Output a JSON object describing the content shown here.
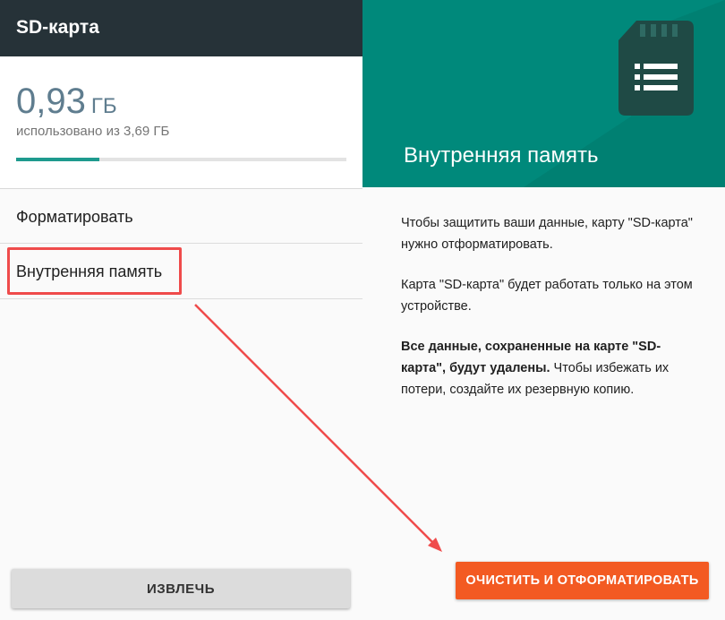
{
  "left_pane": {
    "title": "SD-карта",
    "used_value": "0,93",
    "used_unit": "ГБ",
    "used_caption": "использовано из 3,69 ГБ",
    "usage_fraction": 0.252,
    "menu": [
      {
        "label": "Форматировать"
      },
      {
        "label": "Внутренняя память"
      }
    ],
    "eject_label": "ИЗВЛЕЧЬ"
  },
  "right_pane": {
    "title": "Внутренняя память",
    "paragraph1": "Чтобы защитить ваши данные, карту \"SD-карта\" нужно отформатировать.",
    "paragraph2": "Карта \"SD-карта\" будет работать только на этом устройстве.",
    "paragraph3_bold": "Все данные, сохраненные на карте \"SD-карта\", будут удалены.",
    "paragraph3_rest": " Чтобы избежать их потери, создайте их резервную копию.",
    "format_button_label": "ОЧИСТИТЬ И ОТФОРМАТИРОВАТЬ"
  },
  "colors": {
    "appbar": "#263238",
    "accent_teal": "#00897b",
    "progress_fill": "#1e9a8e",
    "primary_button": "#f35a22",
    "annotation_red": "#ef4b4b"
  },
  "icons": {
    "hero_icon": "sd-card-icon"
  }
}
